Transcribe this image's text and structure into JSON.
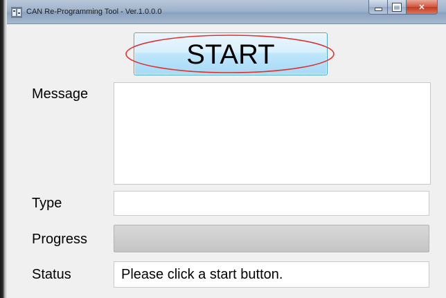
{
  "window": {
    "title": "CAN Re-Programming Tool  - Ver.1.0.0.0",
    "icon": "app-icon"
  },
  "start_button": {
    "label": "START",
    "highlight_color": "#e03030"
  },
  "fields": {
    "message_label": "Message",
    "message_value": "",
    "type_label": "Type",
    "type_value": "",
    "progress_label": "Progress",
    "progress_value": 0,
    "status_label": "Status",
    "status_value": "Please click a start button."
  }
}
